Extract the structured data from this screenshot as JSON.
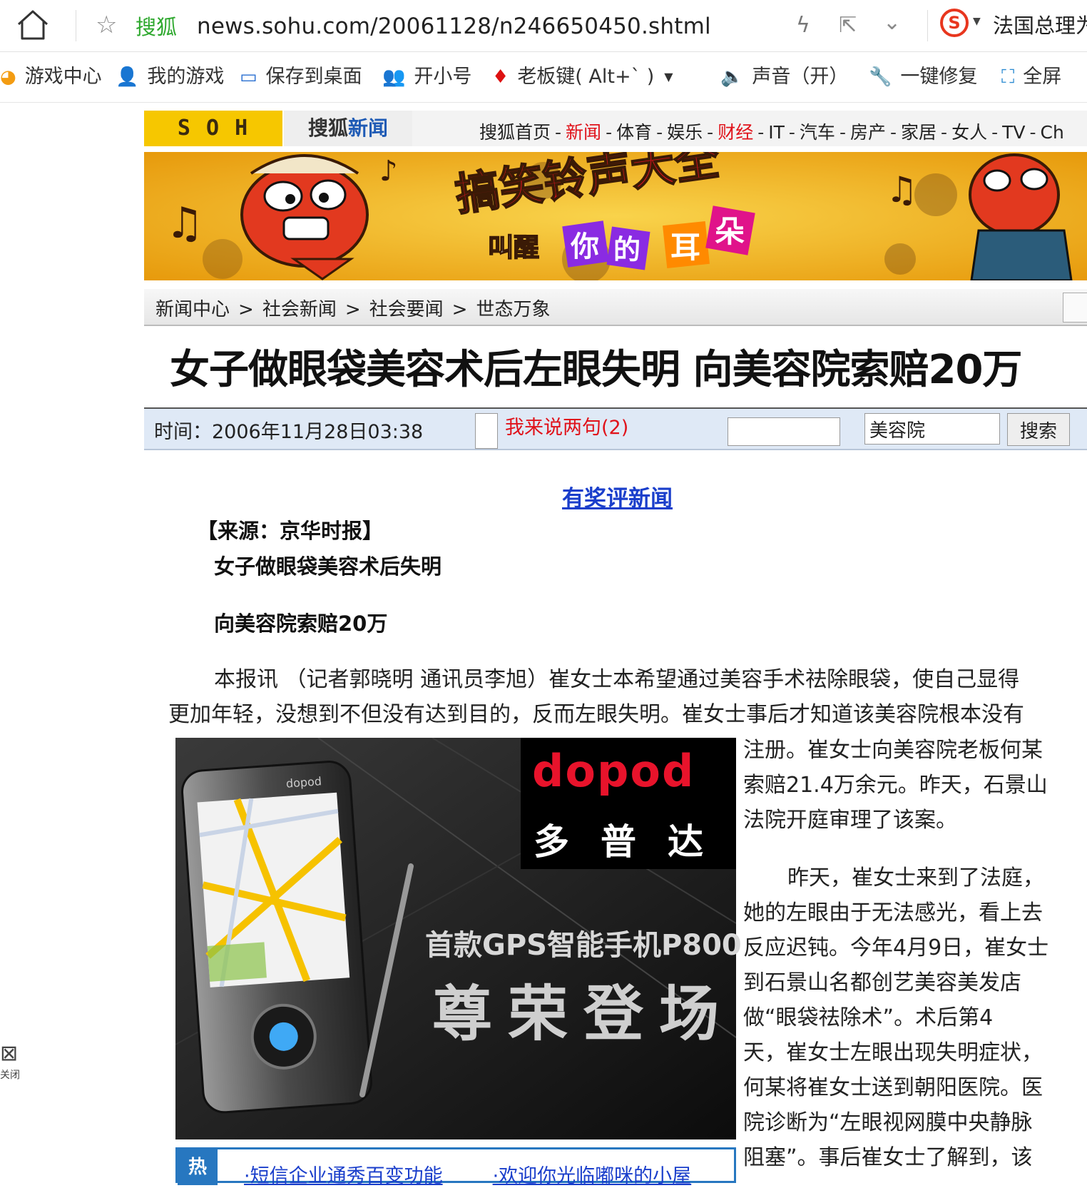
{
  "browser": {
    "site_name": "搜狐",
    "url": "news.sohu.com/20061128/n246650450.shtml",
    "search_hint": "法国总理为"
  },
  "favorites": [
    {
      "label": "游戏中心",
      "icon": "game-center-icon"
    },
    {
      "label": "我的游戏",
      "icon": "user-icon"
    },
    {
      "label": "保存到桌面",
      "icon": "desktop-icon"
    },
    {
      "label": "开小号",
      "icon": "users-icon"
    },
    {
      "label": "老板键( Alt+` )",
      "icon": "tie-icon"
    },
    {
      "label": "声音（开）",
      "icon": "speaker-icon"
    },
    {
      "label": "一键修复",
      "icon": "wrench-icon"
    },
    {
      "label": "全屏",
      "icon": "fullscreen-icon"
    }
  ],
  "header": {
    "logo": "S O H U.com",
    "channel_a": "搜狐",
    "channel_b": "新闻",
    "nav": [
      {
        "label": "搜狐首页",
        "red": false
      },
      {
        "label": "新闻",
        "red": true
      },
      {
        "label": "体育",
        "red": false
      },
      {
        "label": "娱乐",
        "red": false
      },
      {
        "label": "财经",
        "red": true
      },
      {
        "label": "IT",
        "red": false
      },
      {
        "label": "汽车",
        "red": false
      },
      {
        "label": "房产",
        "red": false
      },
      {
        "label": "家居",
        "red": false
      },
      {
        "label": "女人",
        "red": false
      },
      {
        "label": "TV",
        "red": false
      },
      {
        "label": "Ch",
        "red": false
      }
    ]
  },
  "banner": {
    "headline": "搞笑铃声大全",
    "sub_1": "叫醒",
    "sub_2": "你",
    "sub_3": "的",
    "sub_4": "耳",
    "sub_5": "朵",
    "colors": {
      "bg": "#f3b413",
      "headline": "#d8131e"
    }
  },
  "breadcrumb": [
    "新闻中心",
    "社会新闻",
    "社会要闻",
    "世态万象"
  ],
  "breadcrumb_sep": ">",
  "article": {
    "title": "女子做眼袋美容术后左眼失明 向美容院索赔20万",
    "time": "时间：2006年11月28日03:38",
    "comment_link": "我来说两句(2)",
    "search_value": "美容院",
    "search_button": "搜索",
    "prize_link": "有奖评新闻",
    "source": "【来源：京华时报】",
    "sub1": "女子做眼袋美容术后失明",
    "sub2": "向美容院索赔20万",
    "p1": [
      "本报讯 （记者郭晓明 通讯员李旭）崔女士本希望通过美容手术祛除眼袋，使自己显得",
      "更加年轻，没想到不但没有达到目的，反而左眼失明。崔女士事后才知道该美容院根本没有",
      "注册。崔女士向美容院老板何某",
      "索赔21.4万余元。昨天，石景山",
      "法院开庭审理了该案。"
    ],
    "p2": [
      "昨天，崔女士来到了法庭，",
      "她的左眼由于无法感光，看上去",
      "反应迟钝。今年4月9日，崔女士",
      "到石景山名都创艺美容美发店",
      "做“眼袋祛除术”。术后第4",
      "天，崔女士左眼出现失明症状，",
      "何某将崔女士送到朝阳医院。医",
      "院诊断为“左眼视网膜中央静脉",
      "阻塞”。事后崔女士了解到，该"
    ]
  },
  "ad": {
    "brand": "dopod",
    "brand_cn": "多普达",
    "tagline": "首款GPS智能手机P800",
    "headline": "尊荣登场",
    "phone_logo": "dopod"
  },
  "hot": {
    "tag": "热",
    "links": [
      "·短信企业通秀百变功能",
      "·欢迎你光临嘟咪的小屋"
    ]
  },
  "side": {
    "close_label": "关闭"
  }
}
